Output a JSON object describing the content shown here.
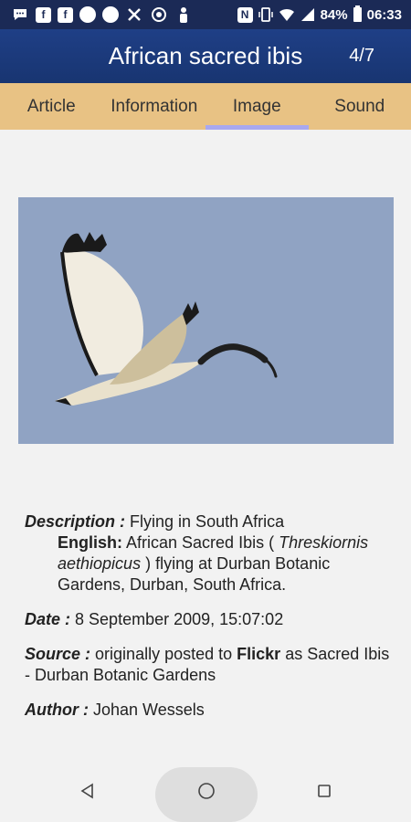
{
  "status": {
    "battery": "84%",
    "time": "06:33"
  },
  "appbar": {
    "title": "African sacred ibis",
    "counter": "4/7"
  },
  "tabs": [
    {
      "label": "Article",
      "active": false
    },
    {
      "label": "Information",
      "active": false
    },
    {
      "label": "Image",
      "active": true
    },
    {
      "label": "Sound",
      "active": false
    }
  ],
  "meta": {
    "description_label": "Description :",
    "description_value": "Flying in South Africa",
    "english_label": "English:",
    "english_text1": "African Sacred Ibis (",
    "english_species": "Threskiornis aethiopicus",
    "english_text2": ") flying at Durban Botanic Gardens, Durban, South Africa.",
    "date_label": "Date :",
    "date_value": "8 September 2009, 15:07:02",
    "source_label": "Source :",
    "source_text1": "originally posted to",
    "source_site": "Flickr",
    "source_text2": "as Sacred Ibis - Durban Botanic Gardens",
    "author_label": "Author :",
    "author_value": "Johan Wessels"
  },
  "colors": {
    "appbar": "#1f3f86",
    "tabs": "#e8c284",
    "tab_indicator": "#a8a8f0",
    "photo_sky": "#90a3c3"
  }
}
